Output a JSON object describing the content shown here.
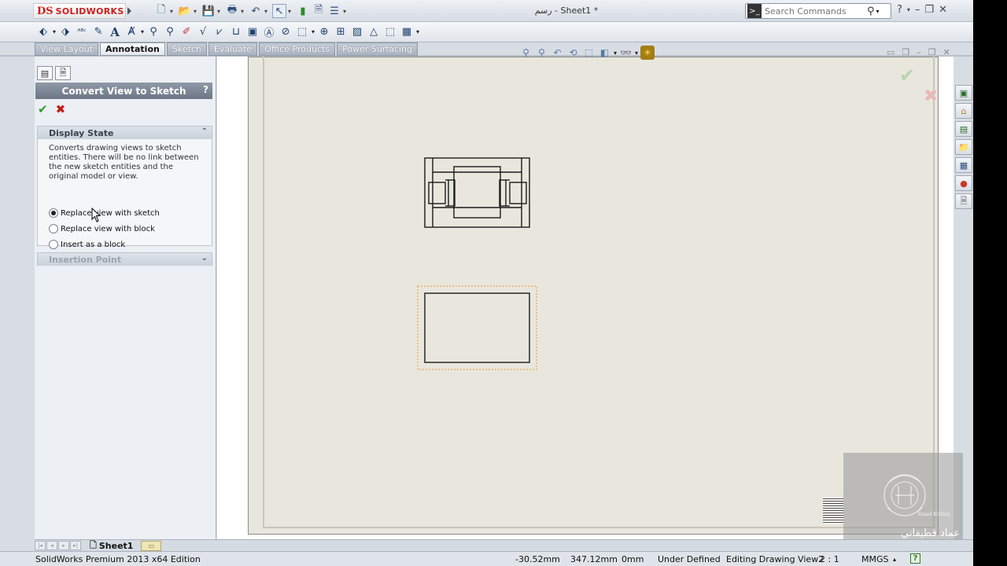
{
  "app": {
    "logo_ds": "DS",
    "logo_name": "SOLIDWORKS",
    "document_title": "رسم - Sheet1 *",
    "search_placeholder": "Search Commands"
  },
  "tabs": [
    {
      "label": "View Layout",
      "active": false
    },
    {
      "label": "Annotation",
      "active": true
    },
    {
      "label": "Sketch",
      "active": false
    },
    {
      "label": "Evaluate",
      "active": false
    },
    {
      "label": "Office Products",
      "active": false
    },
    {
      "label": "Power Surfacing",
      "active": false
    }
  ],
  "property_manager": {
    "title": "Convert View to Sketch",
    "help_label": "?",
    "display_state": {
      "heading": "Display State",
      "description": "Converts drawing views to sketch entities. There will be no link between the new sketch entities and the original model or view.",
      "options": [
        {
          "label": "Replace view with sketch",
          "checked": true
        },
        {
          "label": "Replace view with block",
          "checked": false
        },
        {
          "label": "Insert as a block",
          "checked": false
        }
      ]
    },
    "insertion_point": {
      "heading": "Insertion Point"
    }
  },
  "sheet_tabs": {
    "active": "Sheet1"
  },
  "status_bar": {
    "edition": "SolidWorks Premium 2013 x64 Edition",
    "x_coord": "-30.52mm",
    "y_coord": "347.12mm",
    "z_coord": "0mm",
    "sketch_state": "Under Defined",
    "editing": "Editing Drawing View2",
    "scale": "2 : 1",
    "units": "MMGS",
    "help_icon": "?"
  },
  "watermark": {
    "caption": "Emad Kitfany",
    "name": "عماد قطيفاني"
  },
  "colors": {
    "sheet_background": "#e9e7dd",
    "selection_outline": "#e8962e",
    "ok_green": "#2c9b2c",
    "cancel_red": "#c41818"
  },
  "icons": {
    "ok": "check-icon",
    "cancel": "close-icon",
    "search": "search-icon",
    "help": "help-icon"
  }
}
